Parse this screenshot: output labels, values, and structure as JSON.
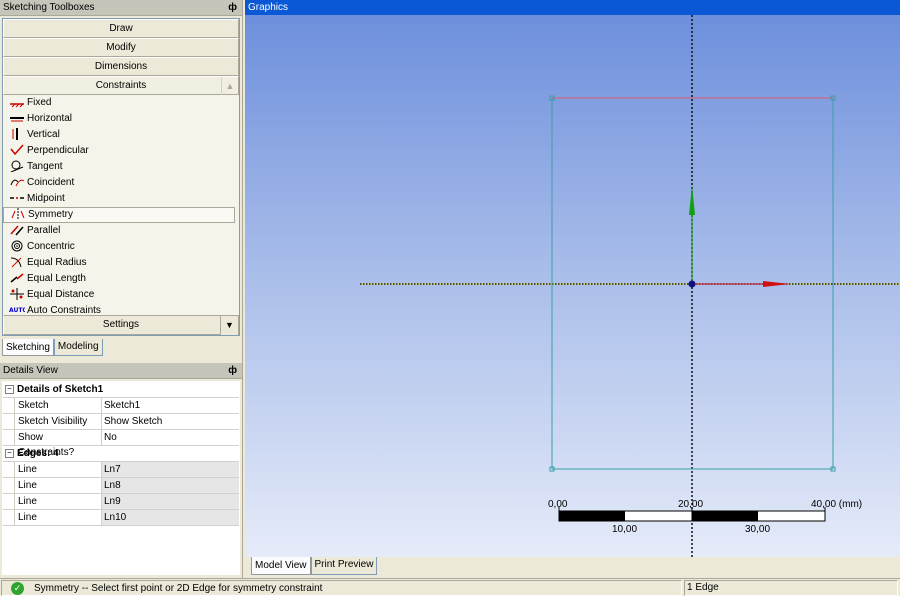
{
  "toolbox": {
    "title": "Sketching Toolboxes",
    "pin": "ф",
    "headers": {
      "draw": "Draw",
      "modify": "Modify",
      "dimensions": "Dimensions",
      "constraints": "Constraints",
      "settings": "Settings"
    },
    "items": [
      {
        "label": "Fixed",
        "icon": "fixed-icon"
      },
      {
        "label": "Horizontal",
        "icon": "horizontal-icon"
      },
      {
        "label": "Vertical",
        "icon": "vertical-icon"
      },
      {
        "label": "Perpendicular",
        "icon": "perpendicular-icon"
      },
      {
        "label": "Tangent",
        "icon": "tangent-icon"
      },
      {
        "label": "Coincident",
        "icon": "coincident-icon"
      },
      {
        "label": "Midpoint",
        "icon": "midpoint-icon"
      },
      {
        "label": "Symmetry",
        "icon": "symmetry-icon",
        "selected": true
      },
      {
        "label": "Parallel",
        "icon": "parallel-icon"
      },
      {
        "label": "Concentric",
        "icon": "concentric-icon"
      },
      {
        "label": "Equal Radius",
        "icon": "equal-radius-icon"
      },
      {
        "label": "Equal Length",
        "icon": "equal-length-icon"
      },
      {
        "label": "Equal Distance",
        "icon": "equal-distance-icon"
      },
      {
        "label": "Auto Constraints",
        "icon": "auto-constraints-icon",
        "badge": "AUTO"
      }
    ],
    "tabs": {
      "sketching": "Sketching",
      "modeling": "Modeling"
    }
  },
  "details": {
    "title": "Details View",
    "pin": "ф",
    "group1": {
      "label": "Details of Sketch1",
      "toggle": "−"
    },
    "rows1": [
      {
        "key": "Sketch",
        "value": "Sketch1"
      },
      {
        "key": "Sketch Visibility",
        "value": "Show Sketch"
      },
      {
        "key": "Show Constraints?",
        "value": "No"
      }
    ],
    "group2": {
      "label": "Edges: 4",
      "toggle": "−"
    },
    "rows2": [
      {
        "key": "Line",
        "value": "Ln7"
      },
      {
        "key": "Line",
        "value": "Ln8"
      },
      {
        "key": "Line",
        "value": "Ln9"
      },
      {
        "key": "Line",
        "value": "Ln10"
      }
    ]
  },
  "graphics": {
    "title": "Graphics",
    "scale": {
      "top_labels": [
        "0,00",
        "20,00",
        "40,00 (mm)"
      ],
      "bottom_labels": [
        "10,00",
        "30,00"
      ]
    },
    "tabs": {
      "model_view": "Model View",
      "print_preview": "Print Preview"
    },
    "colors": {
      "sketch_line": "#3aa0a8",
      "selected_edge": "#e05a6a",
      "x_axis": "#d01010",
      "y_axis": "#10a010",
      "origin": "#101080"
    }
  },
  "status": {
    "message": "Symmetry -- Select first point or 2D Edge for symmetry constraint",
    "selection": "1 Edge",
    "ok_icon": "✓"
  }
}
